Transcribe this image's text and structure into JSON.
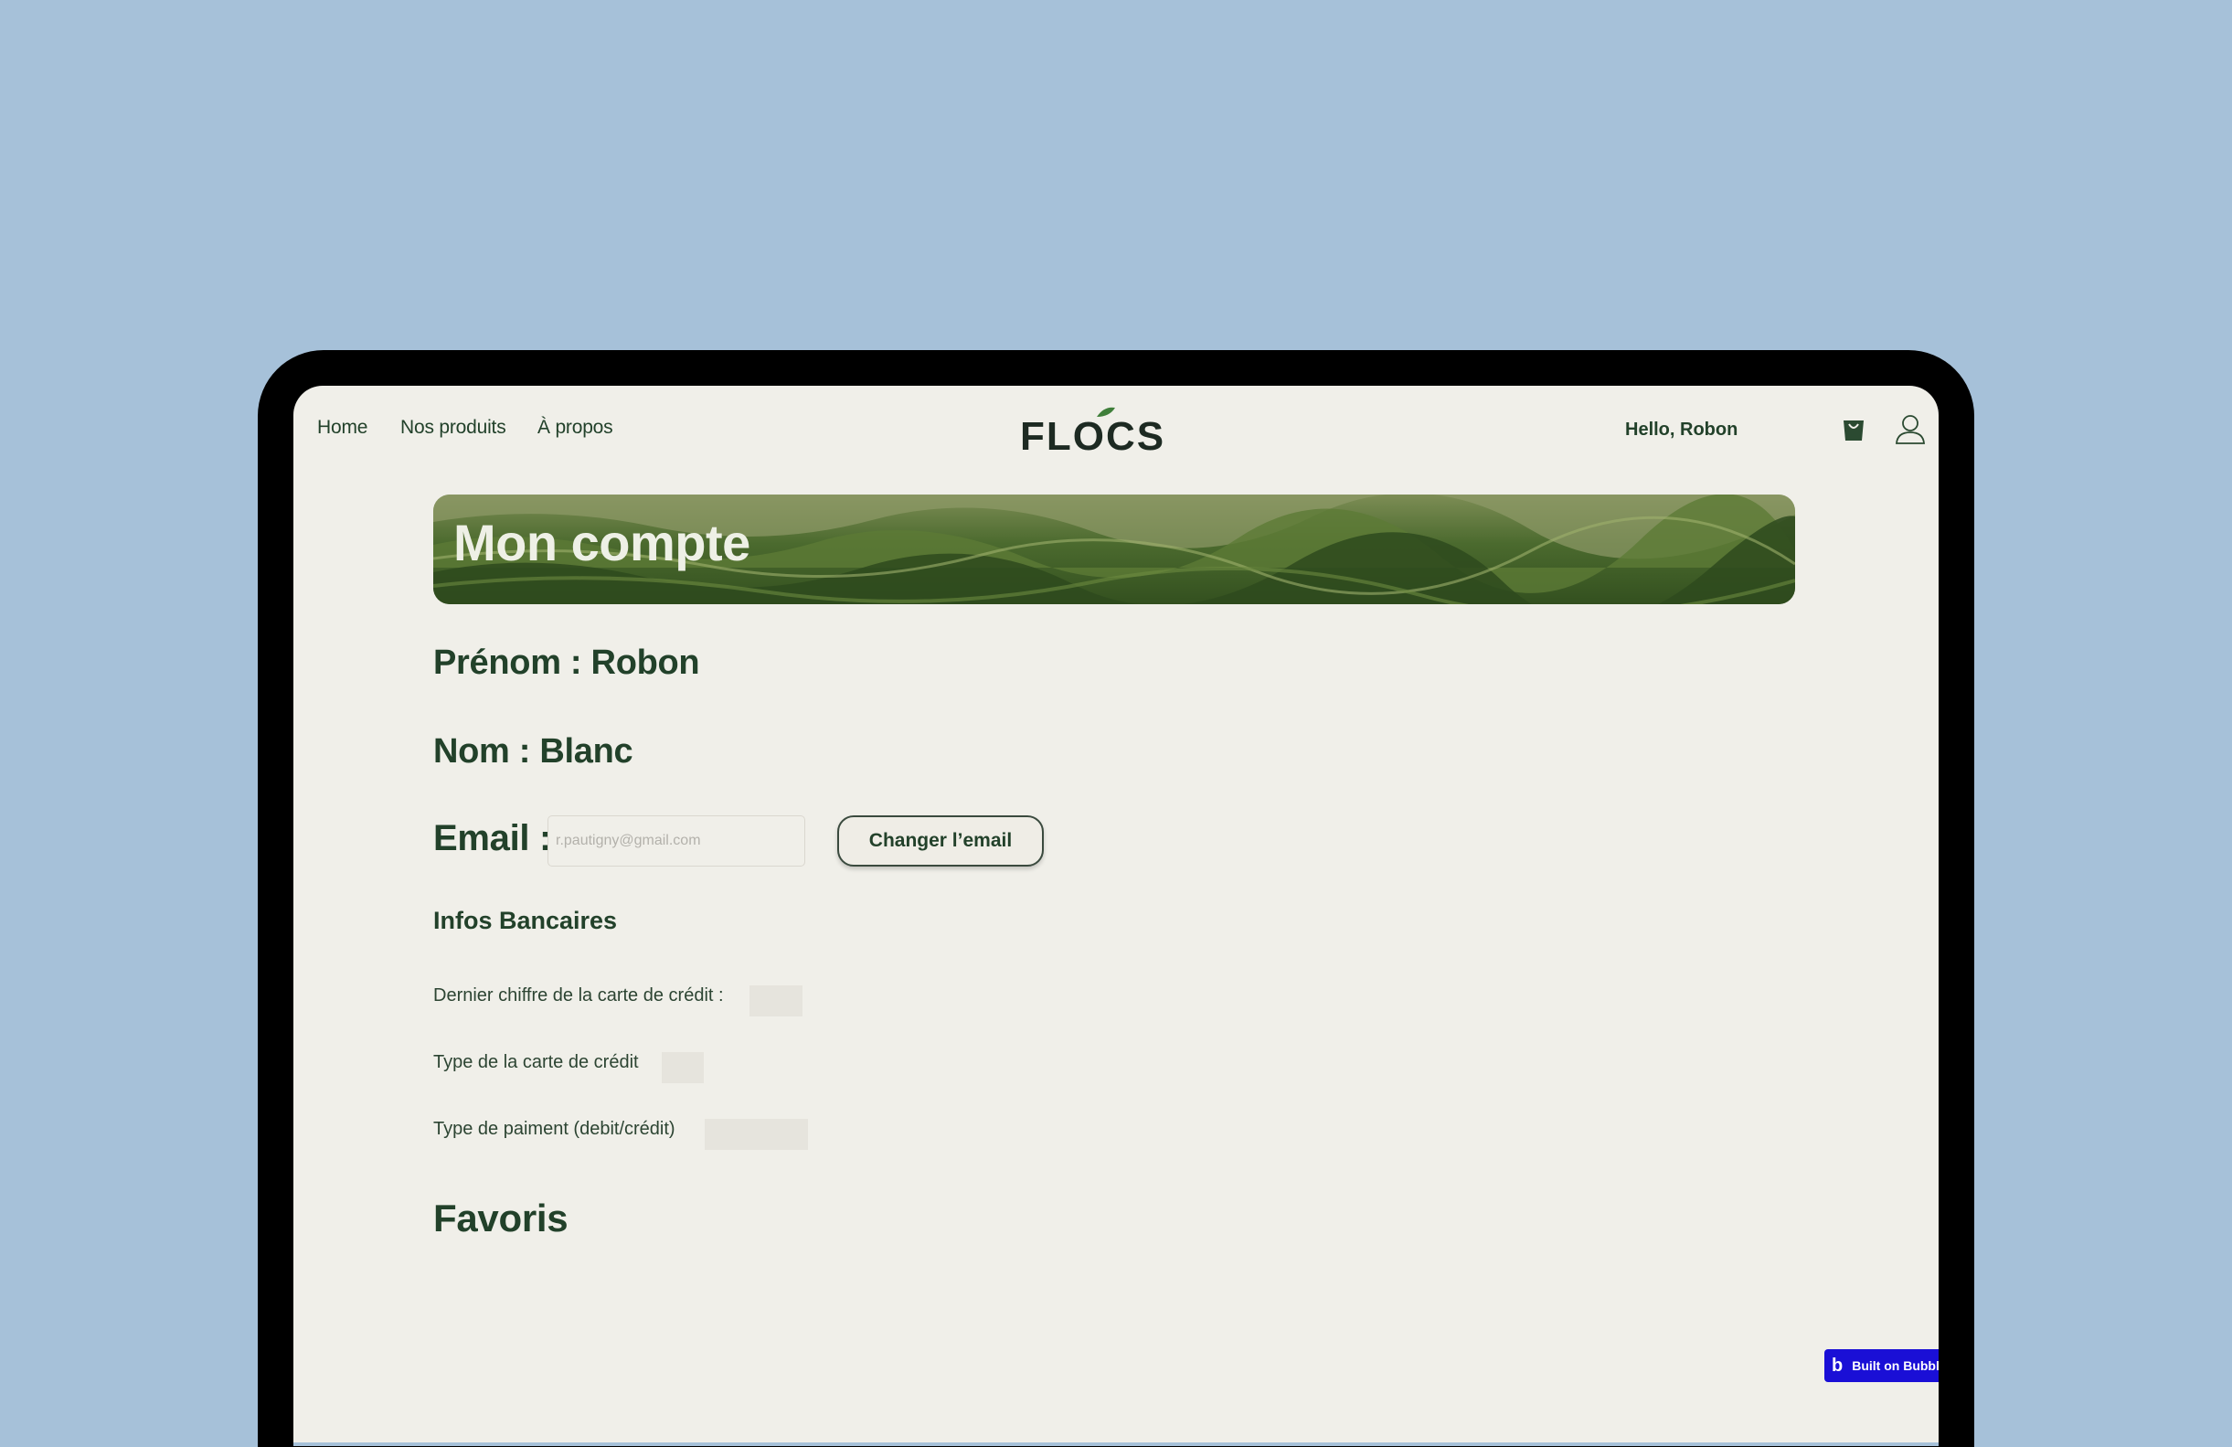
{
  "nav": {
    "links": [
      "Home",
      "Nos produits",
      "À propos"
    ],
    "logo_text": "FLOCS",
    "greeting": "Hello, Robon"
  },
  "banner": {
    "title": "Mon compte"
  },
  "account": {
    "prenom": "Prénom : Robon",
    "nom": "Nom : Blanc",
    "email_label": "Email :",
    "email_placeholder": "r.pautigny@gmail.com",
    "change_email_button": "Changer l’email"
  },
  "banking": {
    "title": "Infos Bancaires",
    "fields": [
      "Dernier chiffre de la carte de crédit :",
      "Type de la carte de crédit",
      "Type de paiment (debit/crédit)"
    ]
  },
  "favoris": {
    "title": "Favoris"
  },
  "badge": {
    "logo": "b",
    "label": "Built on Bubble"
  },
  "colors": {
    "background": "#a6c1d9",
    "page": "#f0efe9",
    "primary_text": "#22412a",
    "badge": "#1a0fd6"
  }
}
